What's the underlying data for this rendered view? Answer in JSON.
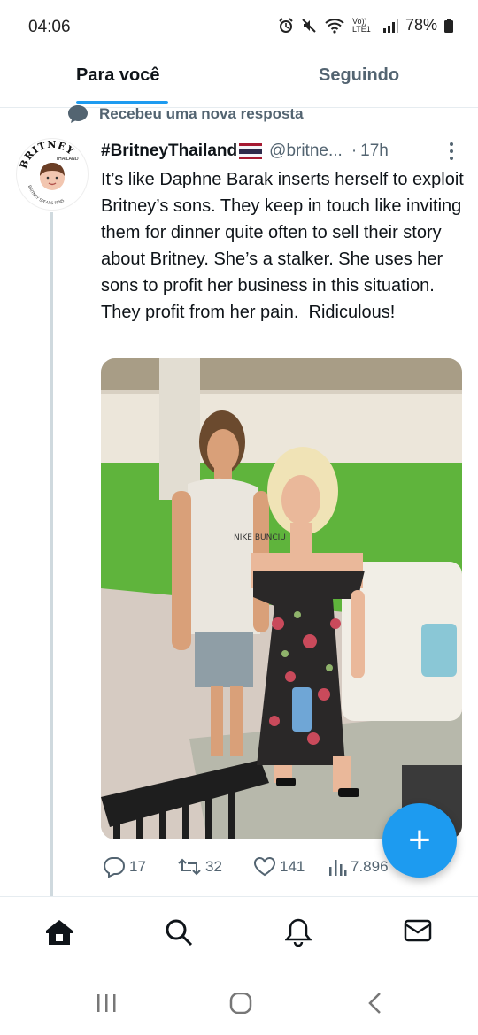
{
  "status_bar": {
    "time": "04:06",
    "battery": "78%",
    "network_label": "Vo)) LTE1"
  },
  "tabs": [
    {
      "label": "Para você",
      "active": true
    },
    {
      "label": "Seguindo",
      "active": false
    }
  ],
  "context": {
    "label": "Recebeu uma nova resposta",
    "icon": "speech-bubble-icon"
  },
  "tweet": {
    "author_name": "#BritneyThailand",
    "flag_icon": "thailand-flag-icon",
    "handle": "@britne...",
    "separator": "·",
    "time": "17h",
    "avatar_text_top": "BRITNEY",
    "avatar_text_mid": "THAILAND",
    "avatar_text_bottom": "BRITNEY SPEARS FANS",
    "text": "It’s like Daphne Barak inserts herself to exploit Britney’s sons. They keep in touch like inviting them for dinner quite often to sell their story about Britney. She’s a stalker. She uses her sons to profit her business in this situation. They profit from her pain.  Ridiculous!",
    "shirt_text": "NIKE\nBUNCIU",
    "actions": {
      "replies": "17",
      "retweets": "32",
      "likes": "141",
      "views": "7.896"
    }
  },
  "colors": {
    "accent": "#1d9bf0",
    "text_primary": "#0f1419",
    "text_secondary": "#536471"
  },
  "bottom_nav": [
    "home-icon",
    "search-icon",
    "notifications-icon",
    "messages-icon"
  ],
  "system_nav": [
    "recent-apps-icon",
    "home-button-icon",
    "back-icon"
  ],
  "fab": {
    "label": "+"
  }
}
